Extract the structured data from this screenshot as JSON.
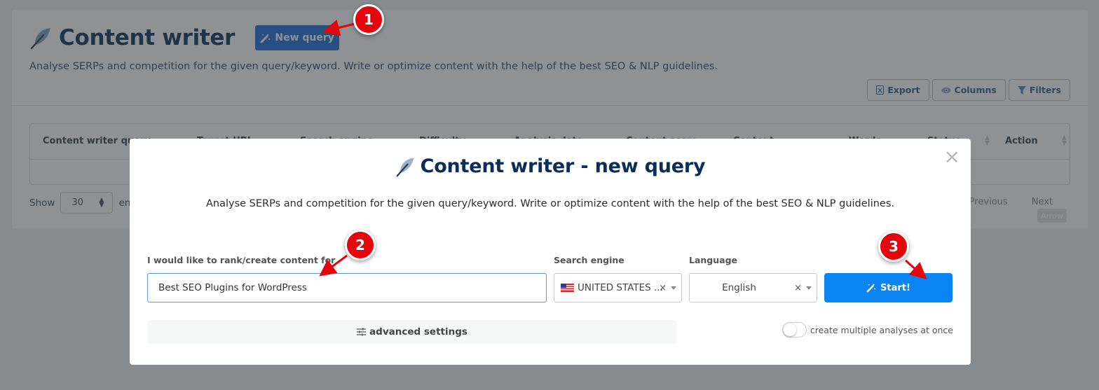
{
  "page": {
    "title": "Content writer",
    "new_query_label": "New query",
    "description": "Analyse SERPs and competition for the given query/keyword. Write or optimize content with the help of the best SEO & NLP guidelines.",
    "toolbar": {
      "export_label": "Export",
      "columns_label": "Columns",
      "filters_label": "Filters"
    },
    "table": {
      "columns": [
        "Content writer query",
        "Target URL",
        "Search engine",
        "Difficulty",
        "Analysis date",
        "Content score",
        "Content",
        "Words",
        "Status",
        "Action"
      ]
    },
    "show_label": "Show",
    "entries_count": "30",
    "entries_label": "entries",
    "pager": {
      "previous_label": "Previous",
      "next_label": "Next",
      "arrow_label": "Arrow"
    }
  },
  "modal": {
    "title": "Content writer - new query",
    "description": "Analyse SERPs and competition for the given query/keyword. Write or optimize content with the help of the best SEO & NLP guidelines.",
    "query_label": "I would like to rank/create content for",
    "query_value": "Best SEO Plugins for WordPress",
    "search_engine_label": "Search engine",
    "search_engine_value": "UNITED STATES ...",
    "language_label": "Language",
    "language_value": "English",
    "start_label": "Start!",
    "advanced_label": "advanced settings",
    "multiple_label": "create multiple analyses at once",
    "multiple_enabled": false,
    "close_symbol": "×"
  },
  "callouts": [
    "1",
    "2",
    "3"
  ],
  "colors": {
    "title": "#0b2e59",
    "primary_button": "#1c6ad4",
    "start_button": "#0b84f4",
    "callout": "#e3050b"
  }
}
